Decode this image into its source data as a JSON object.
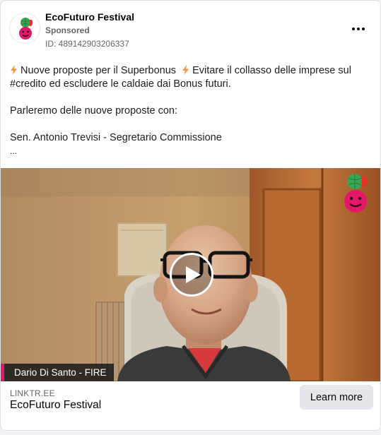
{
  "post": {
    "page_name": "EcoFuturo Festival",
    "sponsored_label": "Sponsored",
    "ad_id": "ID: 489142903206337",
    "more_icon": "more-horizontal-icon",
    "lines": [
      "Nuove proposte per il Superbonus",
      "Evitare il collasso delle imprese sul",
      "#credito ed escludere le caldaie dai Bonus futuri.",
      "Parleremo delle nuove proposte con:",
      "Sen. Antonio Trevisi - Segretario Commissione",
      "..."
    ],
    "bolt_icon": "lightning-bolt-icon",
    "bolt_color": "#f7923a"
  },
  "video": {
    "lower_third": "Dario Di Santo - FIRE",
    "lower_third_accent": "#e5176b",
    "play_icon": "play-icon"
  },
  "footer": {
    "domain": "LINKTR.EE",
    "title": "EcoFuturo Festival",
    "cta_label": "Learn more"
  },
  "brand": {
    "logo_green": "#3aa655",
    "logo_pink": "#e5176b",
    "logo_red": "#e4322b"
  }
}
